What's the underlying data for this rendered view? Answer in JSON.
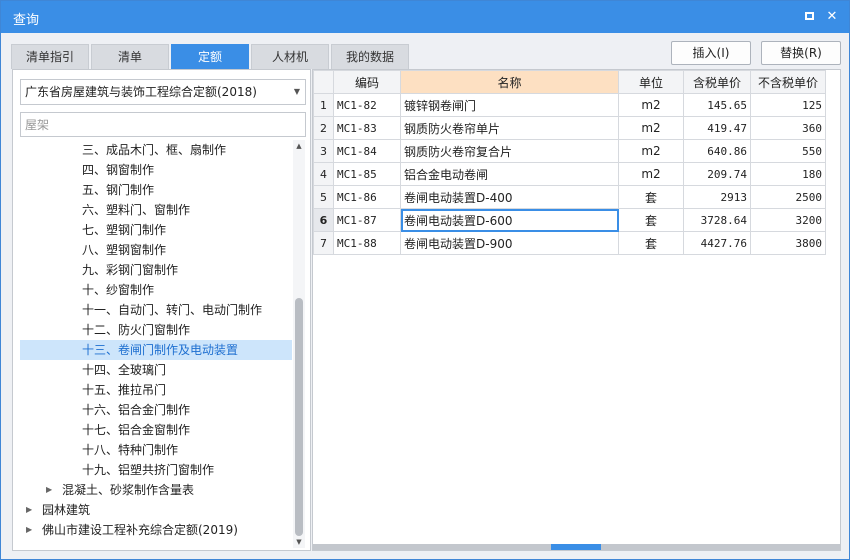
{
  "window": {
    "title": "查询"
  },
  "tabs": [
    {
      "label": "清单指引",
      "active": false
    },
    {
      "label": "清单",
      "active": false
    },
    {
      "label": "定额",
      "active": true
    },
    {
      "label": "人材机",
      "active": false
    },
    {
      "label": "我的数据",
      "active": false
    }
  ],
  "actions": {
    "insert_label": "插入(I)",
    "replace_label": "替换(R)"
  },
  "library_select": {
    "value": "广东省房屋建筑与装饰工程综合定额(2018)"
  },
  "search": {
    "placeholder": "屋架"
  },
  "tree": [
    {
      "label": "三、成品木门、框、扇制作",
      "level": 2
    },
    {
      "label": "四、钢窗制作",
      "level": 2
    },
    {
      "label": "五、钢门制作",
      "level": 2
    },
    {
      "label": "六、塑料门、窗制作",
      "level": 2
    },
    {
      "label": "七、塑钢门制作",
      "level": 2
    },
    {
      "label": "八、塑钢窗制作",
      "level": 2
    },
    {
      "label": "九、彩钢门窗制作",
      "level": 2
    },
    {
      "label": "十、纱窗制作",
      "level": 2
    },
    {
      "label": "十一、自动门、转门、电动门制作",
      "level": 2
    },
    {
      "label": "十二、防火门窗制作",
      "level": 2
    },
    {
      "label": "十三、卷闸门制作及电动装置",
      "level": 2,
      "selected": true
    },
    {
      "label": "十四、全玻璃门",
      "level": 2
    },
    {
      "label": "十五、推拉吊门",
      "level": 2
    },
    {
      "label": "十六、铝合金门制作",
      "level": 2
    },
    {
      "label": "十七、铝合金窗制作",
      "level": 2
    },
    {
      "label": "十八、特种门制作",
      "level": 2
    },
    {
      "label": "十九、铝塑共挤门窗制作",
      "level": 2
    },
    {
      "label": "混凝土、砂浆制作含量表",
      "level": 1,
      "expander": true
    },
    {
      "label": "园林建筑",
      "level": 0,
      "expander": true
    },
    {
      "label": "佛山市建设工程补充综合定额(2019)",
      "level": 0,
      "expander": true
    }
  ],
  "table": {
    "headers": {
      "code": "编码",
      "name": "名称",
      "unit": "单位",
      "tax_price": "含税单价",
      "notax_price": "不含税单价"
    },
    "rows": [
      {
        "idx": "1",
        "code": "MC1-82",
        "name": "镀锌钢卷闸门",
        "unit": "m2",
        "tax_price": "145.65",
        "notax_price": "125"
      },
      {
        "idx": "2",
        "code": "MC1-83",
        "name": "钢质防火卷帘单片",
        "unit": "m2",
        "tax_price": "419.47",
        "notax_price": "360"
      },
      {
        "idx": "3",
        "code": "MC1-84",
        "name": "钢质防火卷帘复合片",
        "unit": "m2",
        "tax_price": "640.86",
        "notax_price": "550"
      },
      {
        "idx": "4",
        "code": "MC1-85",
        "name": "铝合金电动卷闸",
        "unit": "m2",
        "tax_price": "209.74",
        "notax_price": "180"
      },
      {
        "idx": "5",
        "code": "MC1-86",
        "name": "卷闸电动装置D-400",
        "unit": "套",
        "tax_price": "2913",
        "notax_price": "2500"
      },
      {
        "idx": "6",
        "code": "MC1-87",
        "name": "卷闸电动装置D-600",
        "unit": "套",
        "tax_price": "3728.64",
        "notax_price": "3200",
        "current": true
      },
      {
        "idx": "7",
        "code": "MC1-88",
        "name": "卷闸电动装置D-900",
        "unit": "套",
        "tax_price": "4427.76",
        "notax_price": "3800"
      }
    ]
  }
}
